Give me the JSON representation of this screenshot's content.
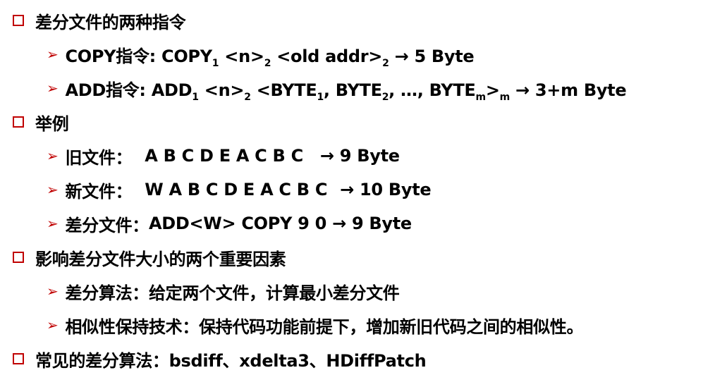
{
  "bullet_colors": {
    "marker": "#c00000",
    "text": "#000000"
  },
  "items": [
    {
      "text": "差分文件的两种指令"
    },
    {
      "text": "举例"
    },
    {
      "text": "影响差分文件大小的两个重要因素"
    },
    {
      "text": "常见的差分算法：bsdiff、xdelta3、HDiffPatch"
    }
  ],
  "copy": {
    "a": "COPY指令: COPY",
    "s1": "1",
    "b": " <n>",
    "s2": "2",
    "c": " <old addr>",
    "s3": "2",
    "d": " → 5 Byte"
  },
  "add": {
    "a": "ADD指令: ADD",
    "s1": "1",
    "b": " <n>",
    "s2": "2",
    "c": " <BYTE",
    "s3": "1",
    "d": ", BYTE",
    "s4": "2",
    "e": ", …, BYTE",
    "s5": "m",
    "f": ">",
    "s6": "m",
    "g": " → 3+m Byte"
  },
  "example": {
    "old_label": "旧文件：",
    "old_value": "A B C D E A C B C",
    "old_size": "→ 9 Byte",
    "new_label": "新文件：",
    "new_value": "W A B C D E A C B C",
    "new_size": "→ 10 Byte",
    "diff_label": "差分文件：",
    "diff_value": "ADD<W> COPY 9 0 → 9 Byte"
  },
  "factors": [
    {
      "text": "差分算法：给定两个文件，计算最小差分文件"
    },
    {
      "text": "相似性保持技术：保持代码功能前提下，增加新旧代码之间的相似性。"
    }
  ]
}
